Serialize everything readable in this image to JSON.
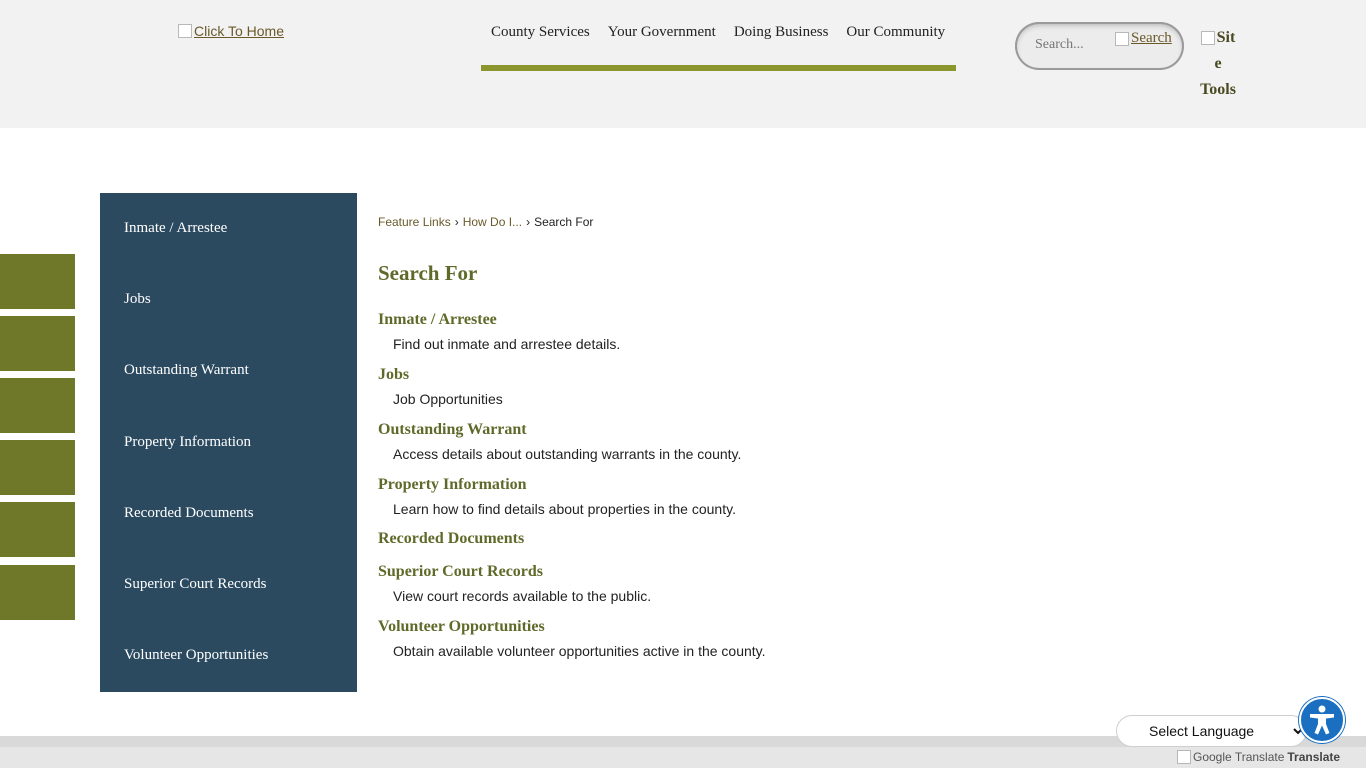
{
  "header": {
    "logo_alt": "Click To Home",
    "nav": [
      "County Services",
      "Your Government",
      "Doing Business",
      "Our Community"
    ],
    "search_placeholder": "Search...",
    "search_button": "Search",
    "site_tools": [
      "Sit",
      "e",
      "Tools"
    ]
  },
  "sidebar": {
    "items": [
      "Inmate / Arrestee",
      "Jobs",
      "Outstanding Warrant",
      "Property Information",
      "Recorded Documents",
      "Superior Court Records",
      "Volunteer Opportunities"
    ]
  },
  "breadcrumb": {
    "items": [
      "Feature Links",
      "How Do I...",
      "Search For"
    ],
    "separator": "›"
  },
  "main": {
    "title": "Search For",
    "entries": [
      {
        "title": "Inmate / Arrestee",
        "desc": "Find out inmate and arrestee details."
      },
      {
        "title": "Jobs",
        "desc": "Job Opportunities"
      },
      {
        "title": "Outstanding Warrant",
        "desc": "Access details about outstanding warrants in the county."
      },
      {
        "title": "Property Information",
        "desc": "Learn how to find details about properties in the county."
      },
      {
        "title": "Recorded Documents",
        "desc": ""
      },
      {
        "title": "Superior Court Records",
        "desc": "View court records available to the public."
      },
      {
        "title": "Volunteer Opportunities",
        "desc": "Obtain available volunteer opportunities active in the county."
      }
    ]
  },
  "footer": {
    "language_select": "Select Language",
    "google_translate_alt": "Google Translate",
    "translate_word": "Translate"
  },
  "colors": {
    "accent_green": "#8c962f",
    "tab_green": "#6f7729",
    "sidebar_blue": "#2b4a60",
    "heading_olive": "#5f6a2a",
    "accessibility_blue": "#1a6fc0"
  },
  "icons": {
    "accessibility": "accessibility-person-icon"
  }
}
